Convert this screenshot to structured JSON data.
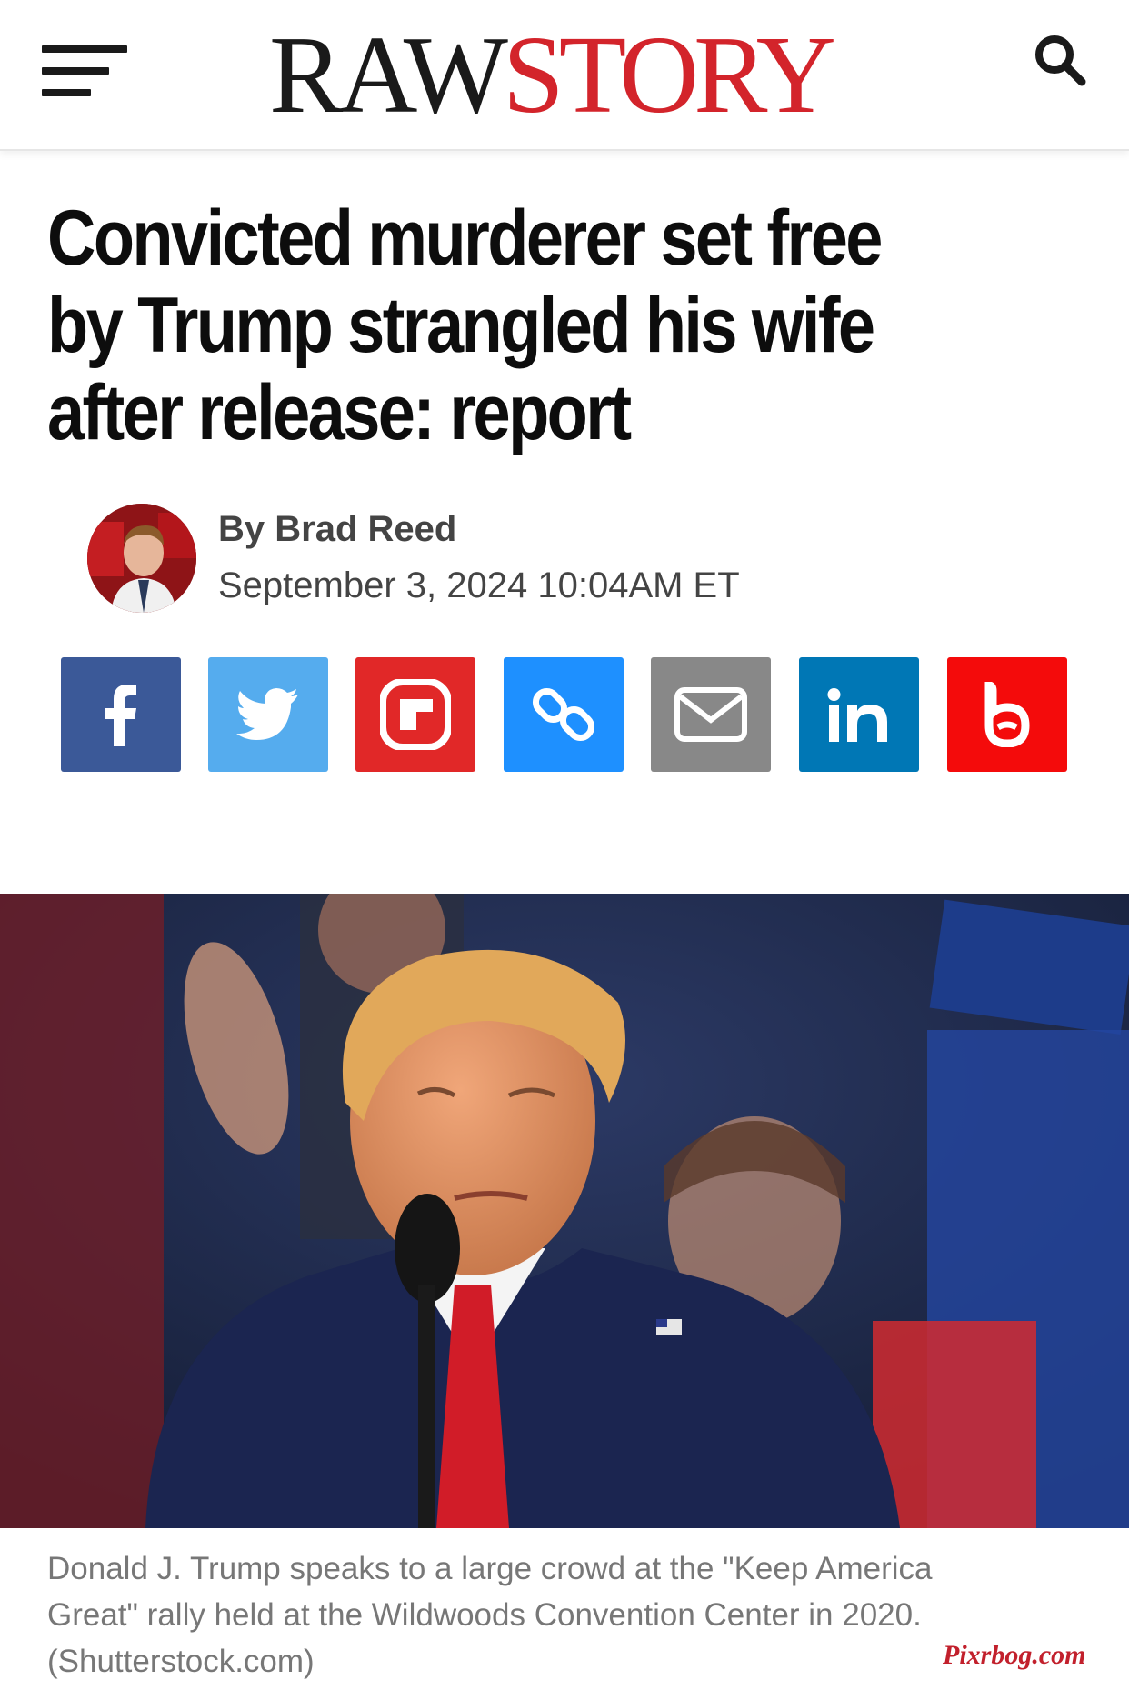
{
  "header": {
    "logo_raw": "RAW",
    "logo_story": "STORY",
    "menu_icon": "hamburger-menu-icon",
    "search_icon": "search-icon",
    "brand_color": "#d3242b"
  },
  "article": {
    "headline": "Convicted murderer set free by Trump strangled his wife after release: report",
    "byline": "By Brad Reed",
    "date": "September 3, 2024 10:04AM ET"
  },
  "share": [
    {
      "name": "facebook",
      "icon": "facebook-icon",
      "color": "#3b5998"
    },
    {
      "name": "twitter",
      "icon": "twitter-icon",
      "color": "#55acee"
    },
    {
      "name": "flipboard",
      "icon": "flipboard-icon",
      "color": "#e12828"
    },
    {
      "name": "copy-link",
      "icon": "link-icon",
      "color": "#1e90ff"
    },
    {
      "name": "email",
      "icon": "email-icon",
      "color": "#888888"
    },
    {
      "name": "linkedin",
      "icon": "linkedin-icon",
      "color": "#0077b5"
    },
    {
      "name": "bluesky-b",
      "icon": "b-logo-icon",
      "color": "#f40b0b"
    }
  ],
  "hero": {
    "caption": "Donald J. Trump speaks to a large crowd at the \"Keep America Great\" rally held at the Wildwoods Convention Center in 2020. (Shutterstock.com)",
    "watermark": "Pixrbog.com"
  }
}
